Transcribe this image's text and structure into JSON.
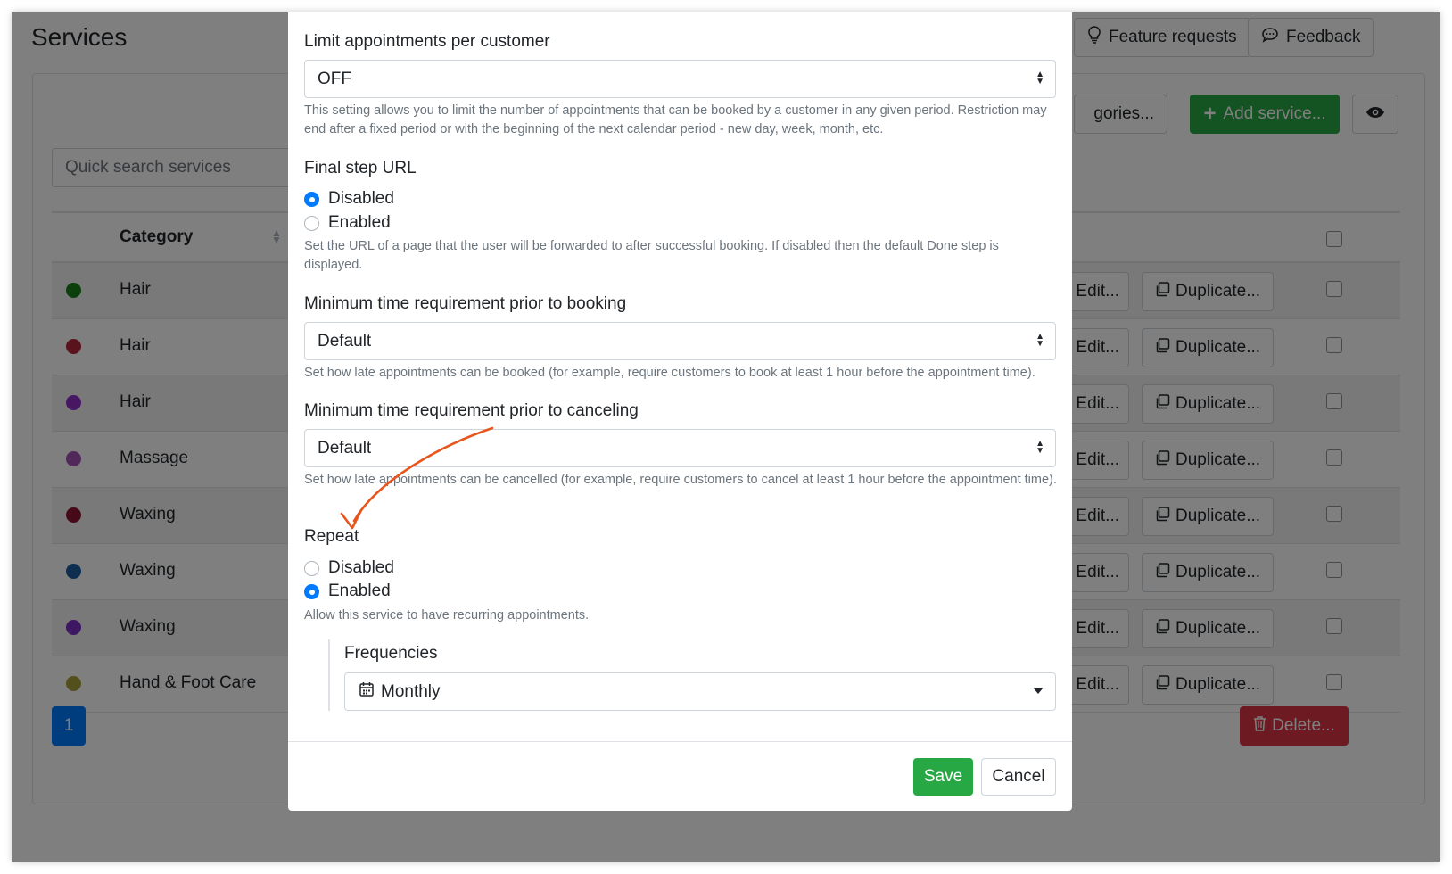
{
  "page": {
    "title": "Services",
    "feature_requests_label": "Feature requests",
    "feedback_label": "Feedback",
    "categories_button_label": "gories...",
    "add_service_label": "Add service...",
    "search_placeholder": "Quick search services",
    "table": {
      "category_header": "Category",
      "rows": [
        {
          "name": "Hair",
          "color": "#1b7f1b"
        },
        {
          "name": "Hair",
          "color": "#b3263a"
        },
        {
          "name": "Hair",
          "color": "#8e2fc7"
        },
        {
          "name": "Massage",
          "color": "#a150b5"
        },
        {
          "name": "Waxing",
          "color": "#8c1330"
        },
        {
          "name": "Waxing",
          "color": "#1d5f9e"
        },
        {
          "name": "Waxing",
          "color": "#7a2fc2"
        },
        {
          "name": "Hand & Foot Care",
          "color": "#a9a03c"
        }
      ],
      "edit_label": "Edit...",
      "duplicate_label": "Duplicate..."
    },
    "pagination_current": "1",
    "delete_label": "Delete..."
  },
  "modal": {
    "limit": {
      "label": "Limit appointments per customer",
      "value": "OFF",
      "help": "This setting allows you to limit the number of appointments that can be booked by a customer in any given period. Restriction may end after a fixed period or with the beginning of the next calendar period - new day, week, month, etc."
    },
    "final_step": {
      "label": "Final step URL",
      "option_disabled": "Disabled",
      "option_enabled": "Enabled",
      "selected": "Disabled",
      "help": "Set the URL of a page that the user will be forwarded to after successful booking. If disabled then the default Done step is displayed."
    },
    "min_booking": {
      "label": "Minimum time requirement prior to booking",
      "value": "Default",
      "help": "Set how late appointments can be booked (for example, require customers to book at least 1 hour before the appointment time)."
    },
    "min_cancel": {
      "label": "Minimum time requirement prior to canceling",
      "value": "Default",
      "help": "Set how late appointments can be cancelled (for example, require customers to cancel at least 1 hour before the appointment time)."
    },
    "repeat": {
      "label": "Repeat",
      "option_disabled": "Disabled",
      "option_enabled": "Enabled",
      "selected": "Enabled",
      "help": "Allow this service to have recurring appointments."
    },
    "frequencies": {
      "label": "Frequencies",
      "value": "Monthly"
    },
    "save_label": "Save",
    "cancel_label": "Cancel"
  },
  "colors": {
    "primary": "#007bff",
    "success": "#28a745",
    "danger": "#dc3545",
    "annotation_arrow": "#e8561e"
  }
}
